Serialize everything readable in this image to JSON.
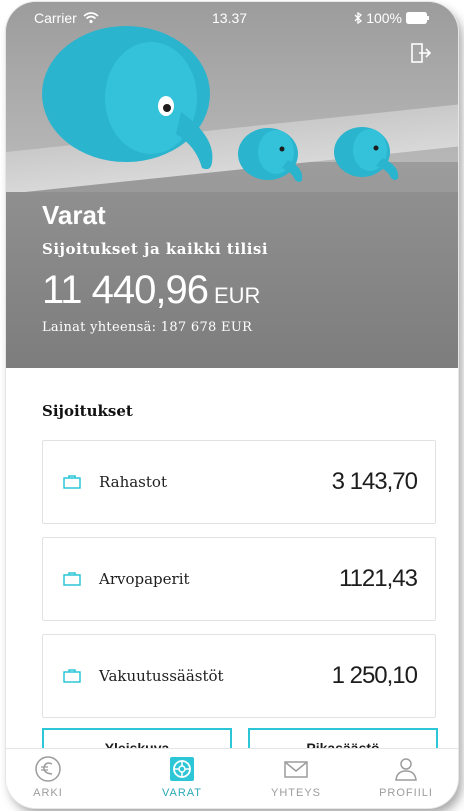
{
  "status_bar": {
    "carrier": "Carrier",
    "time": "13.37",
    "battery": "100%"
  },
  "hero": {
    "title": "Varat",
    "subtitle": "Sijoitukset ja kaikki tilisi",
    "amount": "11 440,96",
    "currency": "EUR",
    "loans": "Lainat yhteensä: 187 678 EUR"
  },
  "section": {
    "title": "Sijoitukset"
  },
  "accounts": [
    {
      "label": "Rahastot",
      "value": "3 143,70"
    },
    {
      "label": "Arvopaperit",
      "value": "1121,43"
    },
    {
      "label": "Vakuutussäästöt",
      "value": "1 250,10"
    }
  ],
  "buttons": {
    "left_label": "Yleiskuva",
    "right_label": "Pikasäästö"
  },
  "tabbar": {
    "tabs": [
      {
        "label": "ARKI",
        "icon": "euro-icon"
      },
      {
        "label": "VARAT",
        "icon": "wheel-icon"
      },
      {
        "label": "YHTEYS",
        "icon": "envelope-icon"
      },
      {
        "label": "PROFIILI",
        "icon": "person-icon"
      }
    ],
    "active_index": 1
  },
  "colors": {
    "accent": "#2cc6d6",
    "accent_text": "#2aa7b8",
    "elephant": "#29b6cf"
  }
}
